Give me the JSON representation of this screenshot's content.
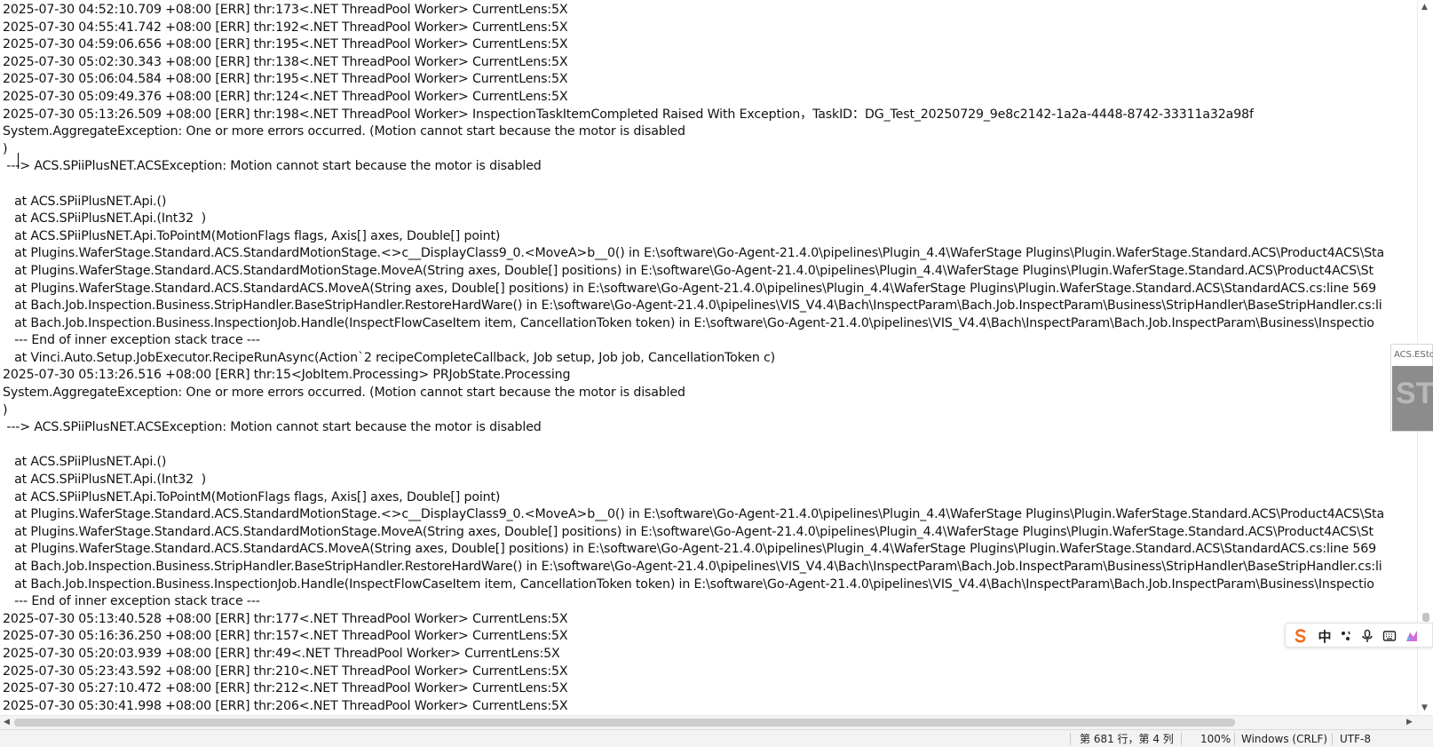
{
  "log": {
    "lines": [
      "2025-07-30 04:52:10.709 +08:00 [ERR] thr:173<.NET ThreadPool Worker> CurrentLens:5X",
      "2025-07-30 04:55:41.742 +08:00 [ERR] thr:192<.NET ThreadPool Worker> CurrentLens:5X",
      "2025-07-30 04:59:06.656 +08:00 [ERR] thr:195<.NET ThreadPool Worker> CurrentLens:5X",
      "2025-07-30 05:02:30.343 +08:00 [ERR] thr:138<.NET ThreadPool Worker> CurrentLens:5X",
      "2025-07-30 05:06:04.584 +08:00 [ERR] thr:195<.NET ThreadPool Worker> CurrentLens:5X",
      "2025-07-30 05:09:49.376 +08:00 [ERR] thr:124<.NET ThreadPool Worker> CurrentLens:5X",
      "2025-07-30 05:13:26.509 +08:00 [ERR] thr:198<.NET ThreadPool Worker> InspectionTaskItemCompleted Raised With Exception，TaskID：DG_Test_20250729_9e8c2142-1a2a-4448-8742-33311a32a98f",
      "System.AggregateException: One or more errors occurred. (Motion cannot start because the motor is disabled",
      ")",
      " ---> ACS.SPiiPlusNET.ACSException: Motion cannot start because the motor is disabled",
      "",
      "   at ACS.SPiiPlusNET.Api.()",
      "   at ACS.SPiiPlusNET.Api.(Int32  )",
      "   at ACS.SPiiPlusNET.Api.ToPointM(MotionFlags flags, Axis[] axes, Double[] point)",
      "   at Plugins.WaferStage.Standard.ACS.StandardMotionStage.<>c__DisplayClass9_0.<MoveA>b__0() in E:\\software\\Go-Agent-21.4.0\\pipelines\\Plugin_4.4\\WaferStage Plugins\\Plugin.WaferStage.Standard.ACS\\Product4ACS\\Sta",
      "   at Plugins.WaferStage.Standard.ACS.StandardMotionStage.MoveA(String axes, Double[] positions) in E:\\software\\Go-Agent-21.4.0\\pipelines\\Plugin_4.4\\WaferStage Plugins\\Plugin.WaferStage.Standard.ACS\\Product4ACS\\St",
      "   at Plugins.WaferStage.Standard.ACS.StandardACS.MoveA(String axes, Double[] positions) in E:\\software\\Go-Agent-21.4.0\\pipelines\\Plugin_4.4\\WaferStage Plugins\\Plugin.WaferStage.Standard.ACS\\StandardACS.cs:line 569",
      "   at Bach.Job.Inspection.Business.StripHandler.BaseStripHandler.RestoreHardWare() in E:\\software\\Go-Agent-21.4.0\\pipelines\\VIS_V4.4\\Bach\\InspectParam\\Bach.Job.InspectParam\\Business\\StripHandler\\BaseStripHandler.cs:li",
      "   at Bach.Job.Inspection.Business.InspectionJob.Handle(InspectFlowCaseItem item, CancellationToken token) in E:\\software\\Go-Agent-21.4.0\\pipelines\\VIS_V4.4\\Bach\\InspectParam\\Bach.Job.InspectParam\\Business\\Inspectio",
      "   --- End of inner exception stack trace ---",
      "   at Vinci.Auto.Setup.JobExecutor.RecipeRunAsync(Action`2 recipeCompleteCallback, Job setup, Job job, CancellationToken c)",
      "2025-07-30 05:13:26.516 +08:00 [ERR] thr:15<JobItem.Processing> PRJobState.Processing",
      "System.AggregateException: One or more errors occurred. (Motion cannot start because the motor is disabled",
      ")",
      " ---> ACS.SPiiPlusNET.ACSException: Motion cannot start because the motor is disabled",
      "",
      "   at ACS.SPiiPlusNET.Api.()",
      "   at ACS.SPiiPlusNET.Api.(Int32  )",
      "   at ACS.SPiiPlusNET.Api.ToPointM(MotionFlags flags, Axis[] axes, Double[] point)",
      "   at Plugins.WaferStage.Standard.ACS.StandardMotionStage.<>c__DisplayClass9_0.<MoveA>b__0() in E:\\software\\Go-Agent-21.4.0\\pipelines\\Plugin_4.4\\WaferStage Plugins\\Plugin.WaferStage.Standard.ACS\\Product4ACS\\Sta",
      "   at Plugins.WaferStage.Standard.ACS.StandardMotionStage.MoveA(String axes, Double[] positions) in E:\\software\\Go-Agent-21.4.0\\pipelines\\Plugin_4.4\\WaferStage Plugins\\Plugin.WaferStage.Standard.ACS\\Product4ACS\\St",
      "   at Plugins.WaferStage.Standard.ACS.StandardACS.MoveA(String axes, Double[] positions) in E:\\software\\Go-Agent-21.4.0\\pipelines\\Plugin_4.4\\WaferStage Plugins\\Plugin.WaferStage.Standard.ACS\\StandardACS.cs:line 569",
      "   at Bach.Job.Inspection.Business.StripHandler.BaseStripHandler.RestoreHardWare() in E:\\software\\Go-Agent-21.4.0\\pipelines\\VIS_V4.4\\Bach\\InspectParam\\Bach.Job.InspectParam\\Business\\StripHandler\\BaseStripHandler.cs:li",
      "   at Bach.Job.Inspection.Business.InspectionJob.Handle(InspectFlowCaseItem item, CancellationToken token) in E:\\software\\Go-Agent-21.4.0\\pipelines\\VIS_V4.4\\Bach\\InspectParam\\Bach.Job.InspectParam\\Business\\Inspectio",
      "   --- End of inner exception stack trace ---",
      "2025-07-30 05:13:40.528 +08:00 [ERR] thr:177<.NET ThreadPool Worker> CurrentLens:5X",
      "2025-07-30 05:16:36.250 +08:00 [ERR] thr:157<.NET ThreadPool Worker> CurrentLens:5X",
      "2025-07-30 05:20:03.939 +08:00 [ERR] thr:49<.NET ThreadPool Worker> CurrentLens:5X",
      "2025-07-30 05:23:43.592 +08:00 [ERR] thr:210<.NET ThreadPool Worker> CurrentLens:5X",
      "2025-07-30 05:27:10.472 +08:00 [ERR] thr:212<.NET ThreadPool Worker> CurrentLens:5X",
      "2025-07-30 05:30:41.998 +08:00 [ERR] thr:206<.NET ThreadPool Worker> CurrentLens:5X"
    ]
  },
  "status_bar": {
    "position": "第 681 行，第 4 列",
    "zoom": "100%",
    "line_ending": "Windows (CRLF)",
    "encoding": "UTF-8"
  },
  "overlay": {
    "label": "ACS.EStop",
    "big_text": "STO"
  },
  "ime_toolbar": {
    "mode": "中",
    "colors": {
      "logo": "#f26b1d",
      "skin": "#d36bd8"
    }
  }
}
